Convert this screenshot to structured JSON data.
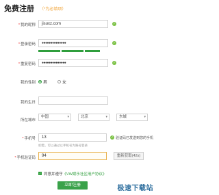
{
  "header": {
    "title": "免费注册",
    "subtitle": "（*为必填项）"
  },
  "form": {
    "nickname": {
      "label": "我的昵称",
      "value": "jisuxz.com"
    },
    "password": {
      "label": "登录密码",
      "value": "●●●●●●●●●●●●●●"
    },
    "confirm_password": {
      "label": "重复密码",
      "value": "●●●●●●●●●●●●●●"
    },
    "gender": {
      "label": "我的性别",
      "options": [
        "男",
        "女"
      ],
      "selected": "男"
    },
    "birthday": {
      "label": "我的生日",
      "value": ""
    },
    "city": {
      "label": "所在城市",
      "province": "中国",
      "city": "北京",
      "district": "东城"
    },
    "phone": {
      "label": "手机号",
      "value": "13",
      "hint": "如需，可以通过以手机号为账号登录",
      "status": "验证码已发送到您的手机"
    },
    "sms_code": {
      "label": "手机验证码",
      "value": "94",
      "resend": "重新获取(42s)"
    },
    "agreement": {
      "prefix": "同意并遵守",
      "link": "《VW娱乐社区用户协议》"
    },
    "submit": "立即注册"
  },
  "watermark": "极速下载站",
  "colors": {
    "accent": "#3aa24a",
    "ok": "#7ac143",
    "required": "#e33333"
  }
}
